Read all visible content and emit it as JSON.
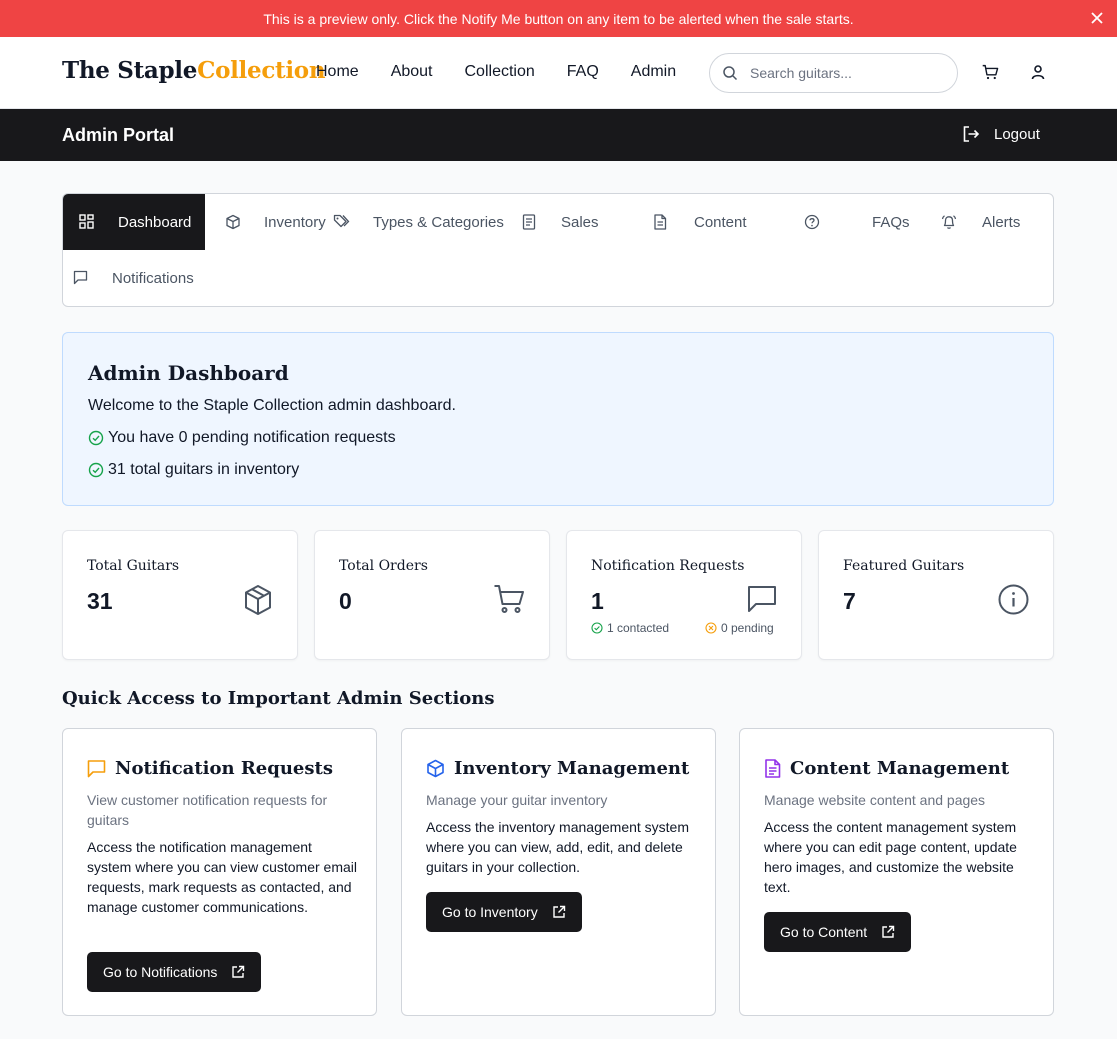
{
  "banner": {
    "text": "This is a preview only. Click the Notify Me button on any item to be alerted when the sale starts."
  },
  "header": {
    "logo_part1": "The Staple",
    "logo_part2": "Collection",
    "nav": [
      "Home",
      "About",
      "Collection",
      "FAQ",
      "Admin"
    ],
    "search_placeholder": "Search guitars..."
  },
  "admin_bar": {
    "title": "Admin Portal",
    "logout": "Logout"
  },
  "tabs": [
    {
      "label": "Dashboard",
      "icon": "grid-icon",
      "active": true
    },
    {
      "label": "Inventory",
      "icon": "box-icon"
    },
    {
      "label": "Types & Categories",
      "icon": "tags-icon"
    },
    {
      "label": "Sales",
      "icon": "receipt-icon"
    },
    {
      "label": "Content",
      "icon": "document-icon"
    },
    {
      "label": "FAQs",
      "icon": "help-circle-icon"
    },
    {
      "label": "Alerts",
      "icon": "bell-icon"
    },
    {
      "label": "Notifications",
      "icon": "message-icon"
    }
  ],
  "welcome": {
    "title": "Admin Dashboard",
    "intro": "Welcome to the Staple Collection admin dashboard.",
    "items": [
      "You have 0 pending notification requests",
      "31 total guitars in inventory"
    ]
  },
  "stats": [
    {
      "label": "Total Guitars",
      "value": "31",
      "icon": "box-icon"
    },
    {
      "label": "Total Orders",
      "value": "0",
      "icon": "cart-icon"
    },
    {
      "label": "Notification Requests",
      "value": "1",
      "icon": "message-icon",
      "contacted": "1 contacted",
      "pending": "0 pending"
    },
    {
      "label": "Featured Guitars",
      "value": "7",
      "icon": "info-icon"
    }
  ],
  "quick_access": {
    "title": "Quick Access to Important Admin Sections",
    "cards": [
      {
        "title": "Notification Requests",
        "subtitle": "View customer notification requests for guitars",
        "description": "Access the notification management system where you can view customer email requests, mark requests as contacted, and manage customer communications.",
        "button": "Go to Notifications",
        "icon": "message-icon",
        "icon_color": "#f59e0b"
      },
      {
        "title": "Inventory Management",
        "subtitle": "Manage your guitar inventory",
        "description": "Access the inventory management system where you can view, add, edit, and delete guitars in your collection.",
        "button": "Go to Inventory",
        "icon": "box-icon",
        "icon_color": "#2563eb"
      },
      {
        "title": "Content Management",
        "subtitle": "Manage website content and pages",
        "description": "Access the content management system where you can edit page content, update hero images, and customize the website text.",
        "button": "Go to Content",
        "icon": "document-icon",
        "icon_color": "#9333ea"
      }
    ]
  },
  "colors": {
    "banner": "#ef4444",
    "dark": "#18181b",
    "accent": "#f59e0b",
    "success": "#16a34a",
    "welcome_bg": "#eff6ff"
  }
}
